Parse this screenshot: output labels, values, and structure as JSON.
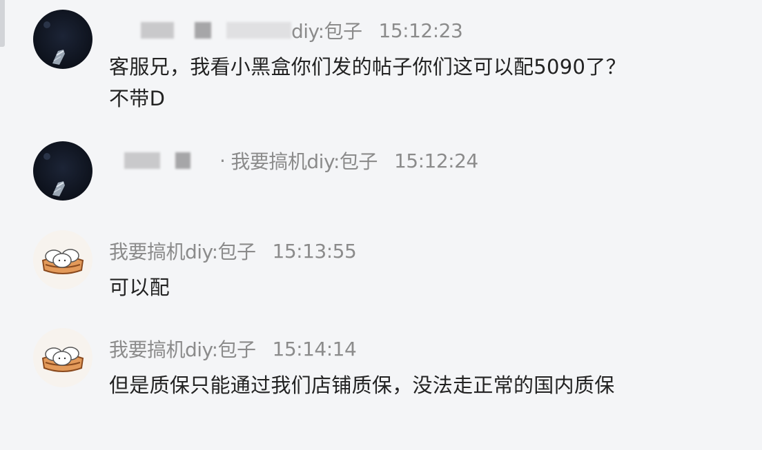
{
  "messages": [
    {
      "sender_suffix": "diy:包子",
      "time": "15:12:23",
      "text": "客服兄，我看小黑盒你们发的帖子你们这可以配5090了？不带D",
      "avatar": "dark-user-avatar"
    },
    {
      "separator": "·",
      "sender_suffix": "我要搞机diy:包子",
      "time": "15:12:24",
      "text": "",
      "avatar": "dark-user-avatar"
    },
    {
      "sender": "我要搞机diy:包子",
      "time": "15:13:55",
      "text": "可以配",
      "avatar": "baozi-steamer-avatar"
    },
    {
      "sender": "我要搞机diy:包子",
      "time": "15:14:14",
      "text": "但是质保只能通过我们店铺质保，没法走正常的国内质保",
      "avatar": "baozi-steamer-avatar"
    }
  ],
  "colors": {
    "background": "#f4f5f7",
    "meta_text": "#8b8b8b",
    "body_text": "#222222"
  }
}
